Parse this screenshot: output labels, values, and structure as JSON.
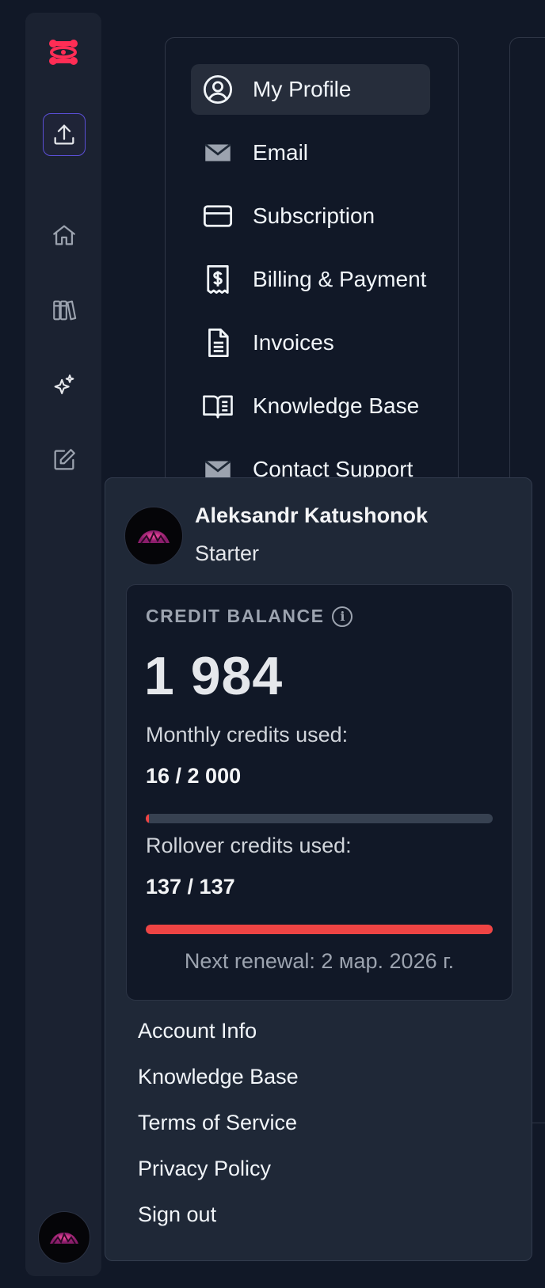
{
  "rail": {
    "icons": [
      "logo-icon",
      "upload-icon",
      "home-icon",
      "library-icon",
      "sparkles-icon",
      "edit-icon"
    ]
  },
  "settings_nav": {
    "items": [
      {
        "label": "My Profile",
        "icon": "user-circle-icon",
        "active": true
      },
      {
        "label": "Email",
        "icon": "mail-icon"
      },
      {
        "label": "Subscription",
        "icon": "credit-card-icon"
      },
      {
        "label": "Billing & Payment",
        "icon": "receipt-dollar-icon"
      },
      {
        "label": "Invoices",
        "icon": "document-icon"
      },
      {
        "label": "Knowledge Base",
        "icon": "book-open-icon"
      },
      {
        "label": "Contact Support",
        "icon": "mail-icon"
      }
    ]
  },
  "account": {
    "name": "Aleksandr Katushonok",
    "plan": "Starter"
  },
  "credits": {
    "label": "CREDIT BALANCE",
    "info_icon": "i",
    "balance": "1 984",
    "monthly_label": "Monthly credits used:",
    "monthly_value": "16 / 2 000",
    "monthly_used_fraction": 0.008,
    "rollover_label": "Rollover credits used:",
    "rollover_value": "137 / 137",
    "rollover_used_fraction": 1.0,
    "renewal": "Next renewal: 2 мар. 2026 г."
  },
  "menu": {
    "account_info": "Account Info",
    "knowledge_base": "Knowledge Base",
    "terms": "Terms of Service",
    "privacy": "Privacy Policy",
    "sign_out": "Sign out"
  },
  "colors": {
    "accent": "#ff2d55",
    "progress": "#ef4444",
    "active_border": "#5b4fd6"
  }
}
